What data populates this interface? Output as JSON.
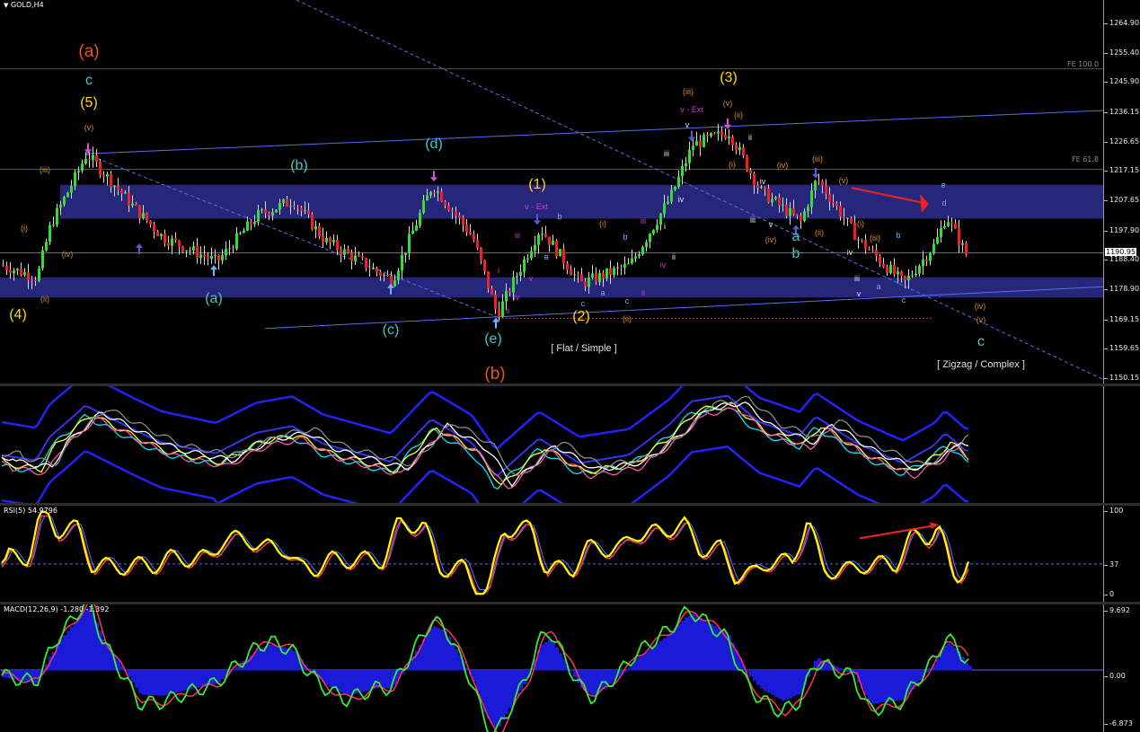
{
  "symbol_title": "GOLD,H4",
  "colors": {
    "background": "#000000",
    "bull_candle": "#33dd33",
    "bear_candle": "#ee2222",
    "zone_band": "#26267a",
    "channel_line": "#5a6cf0",
    "label_orange": "#e8561e",
    "label_yellow": "#ffd700",
    "label_cyan": "#3fc7c7",
    "label_sky": "#6fb0ff",
    "label_magenta": "#d03cd0",
    "label_amber": "#d78c2e",
    "rsi_line": "#ffff00",
    "macd_hist": "#1a1ad8"
  },
  "price_axis": {
    "ticks": [
      "1264.90",
      "1255.40",
      "1245.90",
      "1236.15",
      "1226.65",
      "1217.15",
      "1207.65",
      "1197.90",
      "1188.40",
      "1178.90",
      "1169.15",
      "1159.65",
      "1150.15"
    ],
    "current_price": "1190.95"
  },
  "fib_levels": [
    {
      "label": "FE 100.0",
      "price": 1250.5
    },
    {
      "label": "FE 61.8",
      "price": 1218.0
    }
  ],
  "notes": {
    "flat": "[ Flat / Simple ]",
    "zigzag": "[ Zigzag / Complex ]"
  },
  "wave_labels": [
    {
      "text": "(a)",
      "color": "orange",
      "size": "xl"
    },
    {
      "text": "c",
      "color": "cyan",
      "size": "lg"
    },
    {
      "text": "(5)",
      "color": "yellow",
      "size": "lg"
    },
    {
      "text": "(v)",
      "color": "amber",
      "size": "sm"
    },
    {
      "text": "(iii)",
      "color": "amber",
      "size": "sm"
    },
    {
      "text": "(i)",
      "color": "amber",
      "size": "sm"
    },
    {
      "text": "(iv)",
      "color": "amber",
      "size": "sm"
    },
    {
      "text": "(ii)",
      "color": "amber",
      "size": "sm"
    },
    {
      "text": "(4)",
      "color": "yellow",
      "size": "lg"
    },
    {
      "text": "(b)",
      "color": "cyan",
      "size": "lg"
    },
    {
      "text": "(a)",
      "color": "cyan",
      "size": "lg"
    },
    {
      "text": "(c)",
      "color": "cyan",
      "size": "lg"
    },
    {
      "text": "(d)",
      "color": "cyan",
      "size": "lg"
    },
    {
      "text": "(e)",
      "color": "cyan",
      "size": "lg"
    },
    {
      "text": "(b)",
      "color": "orange",
      "size": "xl"
    },
    {
      "text": "i",
      "color": "magenta",
      "size": "sm"
    },
    {
      "text": "ii",
      "color": "magenta",
      "size": "sm"
    },
    {
      "text": "iii",
      "color": "magenta",
      "size": "sm"
    },
    {
      "text": "iv",
      "color": "magenta",
      "size": "sm"
    },
    {
      "text": "v",
      "color": "magenta",
      "size": "sm"
    },
    {
      "text": "(1)",
      "color": "yellow",
      "size": "lg"
    },
    {
      "text": "v - Ext",
      "color": "magenta",
      "size": "sm"
    },
    {
      "text": "b",
      "color": "sky",
      "size": "sm"
    },
    {
      "text": "a",
      "color": "sky",
      "size": "sm"
    },
    {
      "text": "c",
      "color": "sky",
      "size": "sm"
    },
    {
      "text": "(i)",
      "color": "amber",
      "size": "sm"
    },
    {
      "text": "b",
      "color": "sky",
      "size": "sm"
    },
    {
      "text": "a",
      "color": "sky",
      "size": "sm"
    },
    {
      "text": "c",
      "color": "sky",
      "size": "sm"
    },
    {
      "text": "(2)",
      "color": "yellow",
      "size": "lg"
    },
    {
      "text": "(ii)",
      "color": "amber",
      "size": "sm"
    },
    {
      "text": "iii",
      "color": "magenta",
      "size": "sm"
    },
    {
      "text": "ii",
      "color": "magenta",
      "size": "sm"
    },
    {
      "text": "iv",
      "color": "magenta",
      "size": "sm"
    },
    {
      "text": "i",
      "color": "white",
      "size": "sm"
    },
    {
      "text": "ii",
      "color": "white",
      "size": "sm"
    },
    {
      "text": "iii",
      "color": "white",
      "size": "sm"
    },
    {
      "text": "iv",
      "color": "white",
      "size": "sm"
    },
    {
      "text": "v",
      "color": "white",
      "size": "sm"
    },
    {
      "text": "(iii)",
      "color": "amber",
      "size": "sm"
    },
    {
      "text": "v - Ext",
      "color": "magenta",
      "size": "sm"
    },
    {
      "text": "(3)",
      "color": "yellow",
      "size": "lg"
    },
    {
      "text": "(v)",
      "color": "amber",
      "size": "sm"
    },
    {
      "text": "(ii)",
      "color": "amber",
      "size": "sm"
    },
    {
      "text": "(i)",
      "color": "amber",
      "size": "sm"
    },
    {
      "text": "ii",
      "color": "white",
      "size": "sm"
    },
    {
      "text": "(iv)",
      "color": "amber",
      "size": "sm"
    },
    {
      "text": "iv",
      "color": "white",
      "size": "sm"
    },
    {
      "text": "iii",
      "color": "white",
      "size": "sm"
    },
    {
      "text": "v",
      "color": "white",
      "size": "sm"
    },
    {
      "text": "(iv)",
      "color": "amber",
      "size": "sm"
    },
    {
      "text": "(iii)",
      "color": "amber",
      "size": "sm"
    },
    {
      "text": "b",
      "color": "cyan",
      "size": "lg"
    },
    {
      "text": "a",
      "color": "cyan",
      "size": "lg"
    },
    {
      "text": "(v)",
      "color": "amber",
      "size": "sm"
    },
    {
      "text": "(ii)",
      "color": "amber",
      "size": "sm"
    },
    {
      "text": "(i)",
      "color": "amber",
      "size": "sm"
    },
    {
      "text": "iv",
      "color": "white",
      "size": "sm"
    },
    {
      "text": "iii",
      "color": "white",
      "size": "sm"
    },
    {
      "text": "v",
      "color": "white",
      "size": "sm"
    },
    {
      "text": "(iii)",
      "color": "amber",
      "size": "sm"
    },
    {
      "text": "a",
      "color": "sky",
      "size": "sm"
    },
    {
      "text": "b",
      "color": "sky",
      "size": "sm"
    },
    {
      "text": "c",
      "color": "sky",
      "size": "sm"
    },
    {
      "text": "d",
      "color": "sky",
      "size": "sm"
    },
    {
      "text": "e",
      "color": "sky",
      "size": "sm"
    },
    {
      "text": "(iv)",
      "color": "amber",
      "size": "sm"
    },
    {
      "text": "(v)",
      "color": "amber",
      "size": "sm"
    },
    {
      "text": "c",
      "color": "cyan",
      "size": "lg"
    },
    {
      "text": "(4)",
      "color": "yellow",
      "size": "lg"
    }
  ],
  "indicators": {
    "rsi": {
      "title": "RSI(5) 54.9796",
      "ticks": [
        "100",
        "37",
        "0"
      ],
      "level": 37
    },
    "macd": {
      "title": "MACD(12,26,9) -1.280 -1.392",
      "ticks": [
        "9.692",
        "0.00",
        "-6.873"
      ]
    }
  },
  "chart_data": {
    "type": "candlestick",
    "title": "GOLD,H4",
    "ylim": [
      1150.15,
      1264.9
    ],
    "key_price_path": [
      {
        "wave": "(4)",
        "price": 1184
      },
      {
        "wave": "(5)",
        "price": 1223
      },
      {
        "wave": "(a)",
        "price": 1188
      },
      {
        "wave": "(b)",
        "price": 1208
      },
      {
        "wave": "(c)",
        "price": 1182
      },
      {
        "wave": "(d)",
        "price": 1213
      },
      {
        "wave": "(e)",
        "price": 1171
      },
      {
        "wave": "(1)",
        "price": 1199
      },
      {
        "wave": "(2)",
        "price": 1181
      },
      {
        "wave": "(3)",
        "price": 1230
      },
      {
        "wave": "a",
        "price": 1201
      },
      {
        "wave": "b",
        "price": 1215
      },
      {
        "wave": "c",
        "price": 1181
      }
    ],
    "zones": [
      [
        1202,
        1213
      ],
      [
        1176.5,
        1183
      ]
    ],
    "current_price": 1190.95,
    "indicators": {
      "rsi_period": 5,
      "rsi_value": 54.9796,
      "rsi_level": 37,
      "macd_params": [
        12,
        26,
        9
      ],
      "macd_values": [
        -1.28,
        -1.392
      ]
    }
  }
}
